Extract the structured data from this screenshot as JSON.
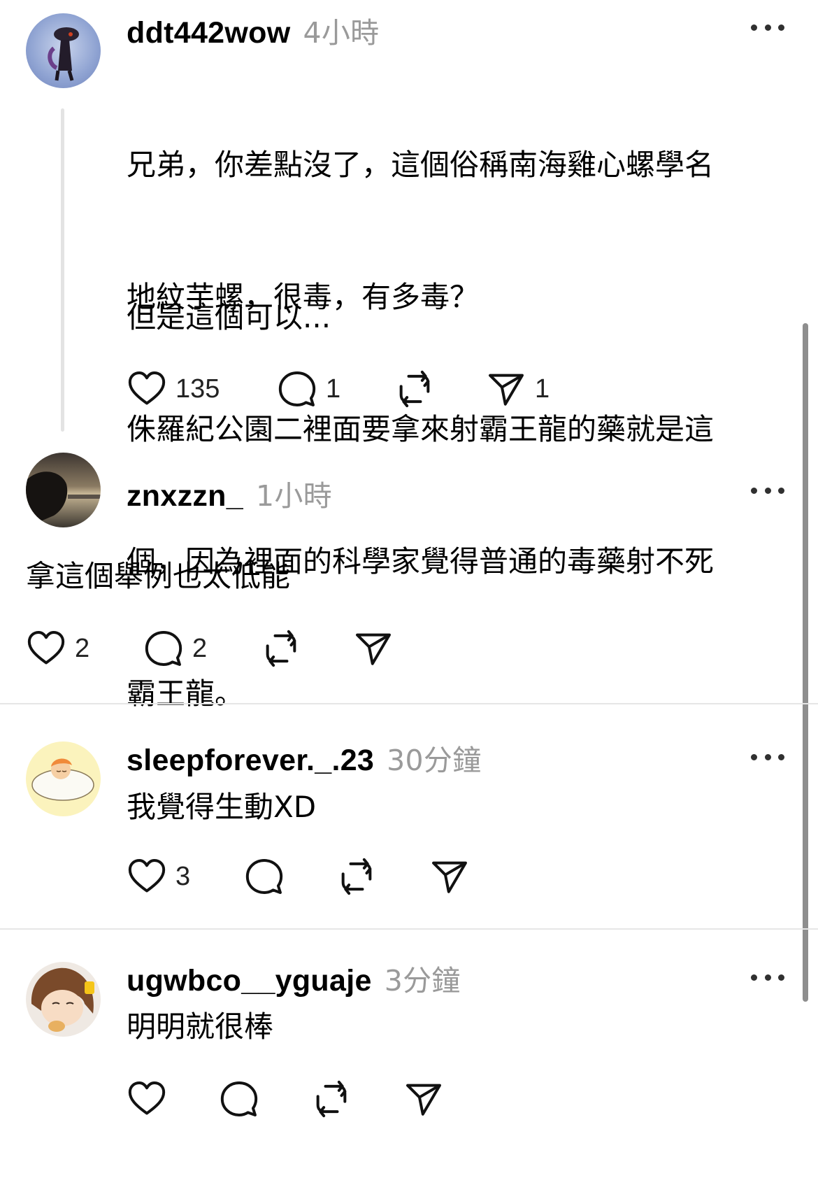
{
  "posts": [
    {
      "username": "ddt442wow",
      "time": "4小時",
      "lines": [
        "兄弟，你差點沒了，這個俗稱南海雞心螺學名",
        "地紋芋螺，很毒，有多毒？",
        "侏羅紀公園二裡面要拿來射霸王龍的藥就是這",
        "個，因為裡面的科學家覺得普通的毒藥射不死",
        "霸王龍。"
      ],
      "line2": "但是這個可以...",
      "likes": "135",
      "replies": "1",
      "shares": "1"
    },
    {
      "username": "znxzzn_",
      "time": "1小時",
      "text": "拿這個舉例也太低能",
      "likes": "2",
      "replies": "2"
    },
    {
      "username": "sleepforever._.23",
      "time": "30分鐘",
      "text": "我覺得生動XD",
      "likes": "3"
    },
    {
      "username": "ugwbco__yguaje",
      "time": "3分鐘",
      "text": "明明就很棒"
    }
  ],
  "icons": [
    "heart-icon",
    "comment-icon",
    "repost-icon",
    "send-icon",
    "more-icon"
  ]
}
